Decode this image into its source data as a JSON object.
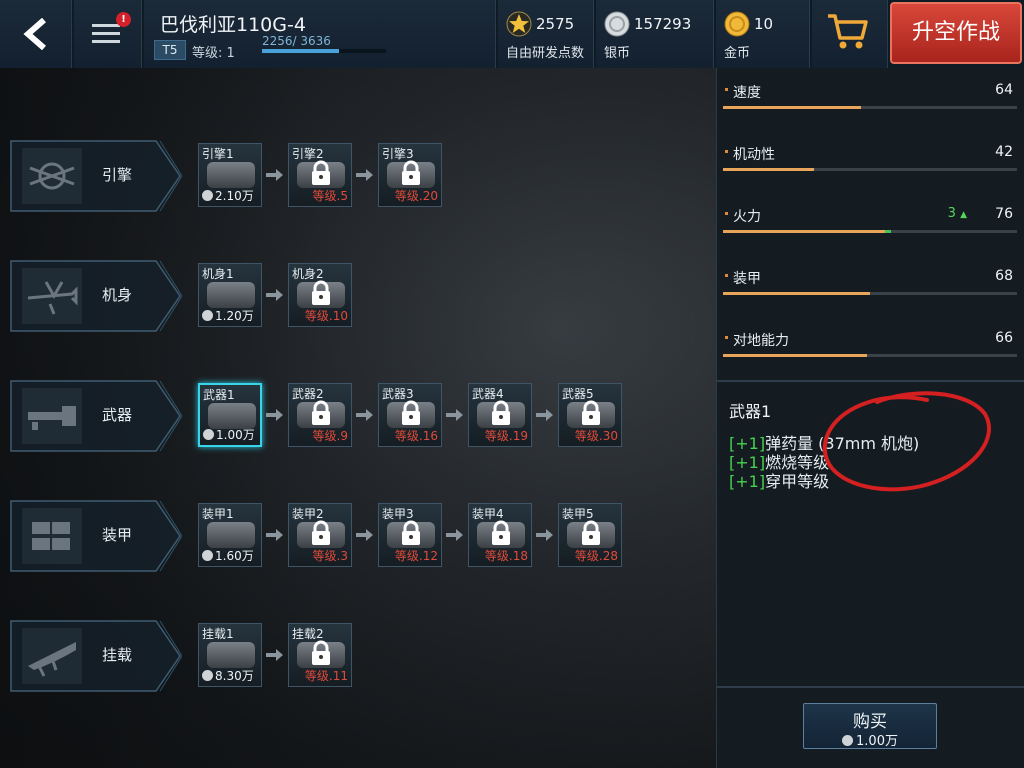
{
  "header": {
    "plane_name": "巴伐利亚110G-4",
    "tier": "T5",
    "level_label": "等级: 1",
    "xp_text": "2256/ 3636",
    "xp_progress": 0.62,
    "menu_badge": "!",
    "sortie_label": "升空作战",
    "resources": [
      {
        "name": "research",
        "icon": "star-icon",
        "value": "2575",
        "label": "自由研发点数"
      },
      {
        "name": "silver",
        "icon": "silver-coin-icon",
        "value": "157293",
        "label": "银币"
      },
      {
        "name": "gold",
        "icon": "gold-coin-icon",
        "value": "10",
        "label": "金币"
      }
    ]
  },
  "categories": [
    {
      "label": "引擎",
      "icon": "engine-icon"
    },
    {
      "label": "机身",
      "icon": "airframe-icon"
    },
    {
      "label": "武器",
      "icon": "weapon-icon"
    },
    {
      "label": "装甲",
      "icon": "armor-icon"
    },
    {
      "label": "挂载",
      "icon": "payload-icon"
    }
  ],
  "rows": [
    [
      {
        "name": "引擎1",
        "price": "2.10万",
        "locked": false
      },
      {
        "name": "引擎2",
        "req": "等级.5",
        "locked": true
      },
      {
        "name": "引擎3",
        "req": "等级.20",
        "locked": true
      }
    ],
    [
      {
        "name": "机身1",
        "price": "1.20万",
        "locked": false
      },
      {
        "name": "机身2",
        "req": "等级.10",
        "locked": true
      }
    ],
    [
      {
        "name": "武器1",
        "price": "1.00万",
        "locked": false,
        "selected": true
      },
      {
        "name": "武器2",
        "req": "等级.9",
        "locked": true
      },
      {
        "name": "武器3",
        "req": "等级.16",
        "locked": true
      },
      {
        "name": "武器4",
        "req": "等级.19",
        "locked": true
      },
      {
        "name": "武器5",
        "req": "等级.30",
        "locked": true
      }
    ],
    [
      {
        "name": "装甲1",
        "price": "1.60万",
        "locked": false
      },
      {
        "name": "装甲2",
        "req": "等级.3",
        "locked": true
      },
      {
        "name": "装甲3",
        "req": "等级.12",
        "locked": true
      },
      {
        "name": "装甲4",
        "req": "等级.18",
        "locked": true
      },
      {
        "name": "装甲5",
        "req": "等级.28",
        "locked": true
      }
    ],
    [
      {
        "name": "挂载1",
        "price": "8.30万",
        "locked": false
      },
      {
        "name": "挂载2",
        "req": "等级.11",
        "locked": true
      }
    ]
  ],
  "stats": [
    {
      "label": "速度",
      "value": "64",
      "fill": 0.47
    },
    {
      "label": "机动性",
      "value": "42",
      "fill": 0.31
    },
    {
      "label": "火力",
      "value": "76",
      "increase": "3",
      "fill": 0.55,
      "increase_fill": 0.02
    },
    {
      "label": "装甲",
      "value": "68",
      "fill": 0.5
    },
    {
      "label": "对地能力",
      "value": "66",
      "fill": 0.49
    }
  ],
  "detail": {
    "title": "武器1",
    "effects": [
      {
        "plus": "[+1]",
        "text": "弹药量 (37mm 机炮)"
      },
      {
        "plus": "[+1]",
        "text": "燃烧等级"
      },
      {
        "plus": "[+1]",
        "text": "穿甲等级"
      }
    ]
  },
  "buy": {
    "label": "购买",
    "price": "1.00万"
  },
  "colors": {
    "accent_cyan": "#39d4e8",
    "lock_red": "#e24a3a",
    "stat_fill": "#e8a55a",
    "increase_green": "#46d24f",
    "sortie_red": "#c2352b"
  }
}
